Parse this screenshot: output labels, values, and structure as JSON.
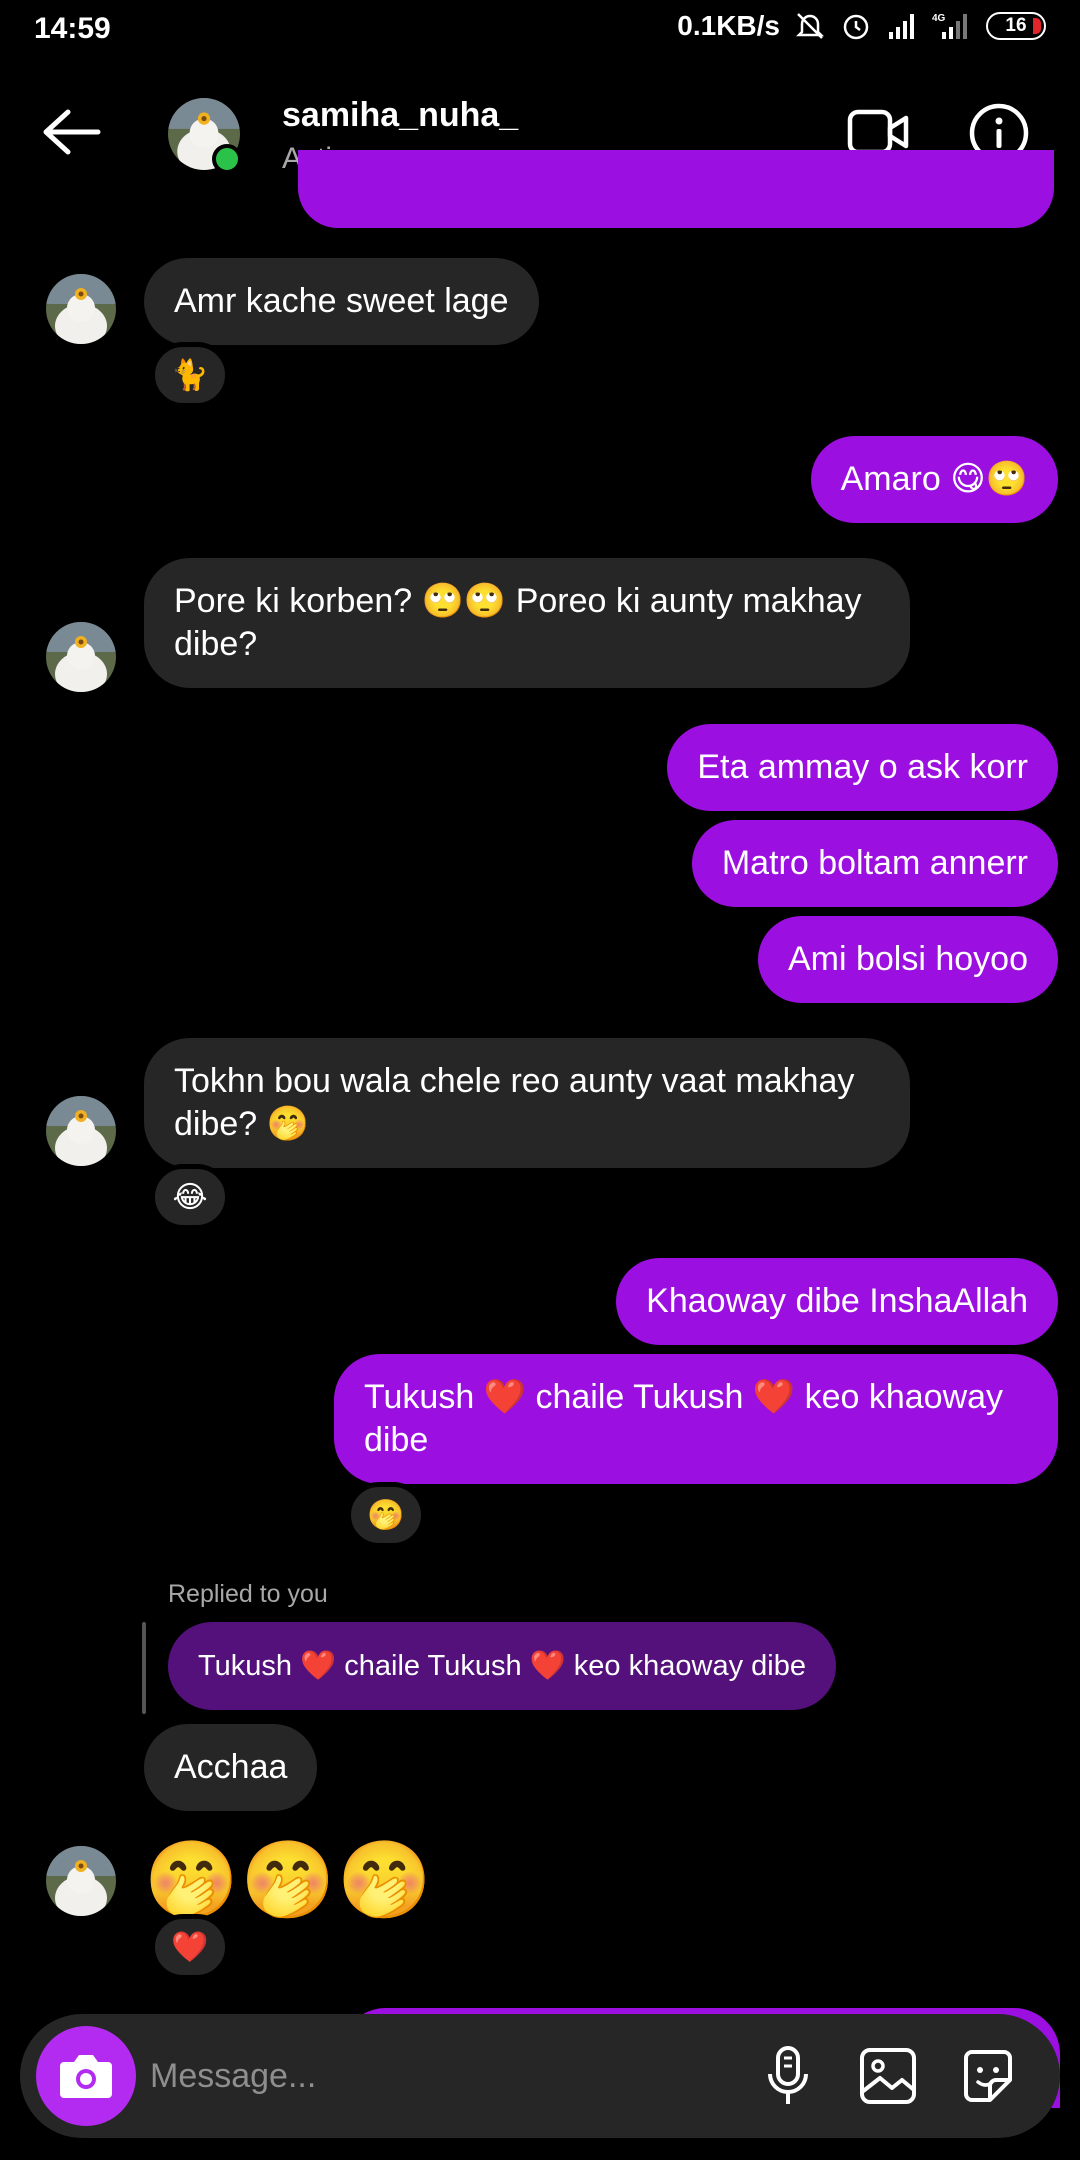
{
  "status_bar": {
    "time": "14:59",
    "network_speed": "0.1KB/s",
    "network_type": "4G",
    "battery": "16"
  },
  "header": {
    "username": "samiha_nuha_",
    "activity": "Active now"
  },
  "messages": {
    "m1": {
      "text": "Amr kache sweet lage",
      "reaction": "🐈"
    },
    "m2": {
      "text": "Amaro 😋🙄"
    },
    "m3": {
      "text": "Pore ki korben? 🙄🙄 Poreo ki aunty makhay dibe?"
    },
    "m4": {
      "text": "Eta ammay o ask korr"
    },
    "m5": {
      "text": "Matro boltam annerr"
    },
    "m6": {
      "text": "Ami bolsi hoyoo"
    },
    "m7": {
      "text": "Tokhn bou wala chele reo aunty vaat makhay dibe? 🤭",
      "reaction": "😂"
    },
    "m8": {
      "text": "Khaoway dibe InshaAllah"
    },
    "m9": {
      "text": "Tukush ❤️ chaile Tukush ❤️ keo khaoway dibe",
      "reaction": "🤭"
    },
    "reply": {
      "label": "Replied to you",
      "quoted": "Tukush ❤️ chaile Tukush ❤️ keo khaoway dibe"
    },
    "m10": {
      "text": "Acchaa"
    },
    "m11": {
      "text": "🤭🤭🤭",
      "reaction": "❤️"
    }
  },
  "composer": {
    "placeholder": "Message..."
  },
  "colors": {
    "outgoing_bubble": "#9b0fe0",
    "incoming_bubble": "#262626",
    "reply_bubble": "#54117c",
    "camera_button": "#b32bf0",
    "online_indicator": "#2bc24a"
  },
  "icons": {
    "back": "arrow-left-icon",
    "video": "video-camera-icon",
    "info": "info-icon",
    "camera": "camera-icon",
    "mic": "microphone-icon",
    "gallery": "image-icon",
    "sticker": "sticker-icon"
  }
}
